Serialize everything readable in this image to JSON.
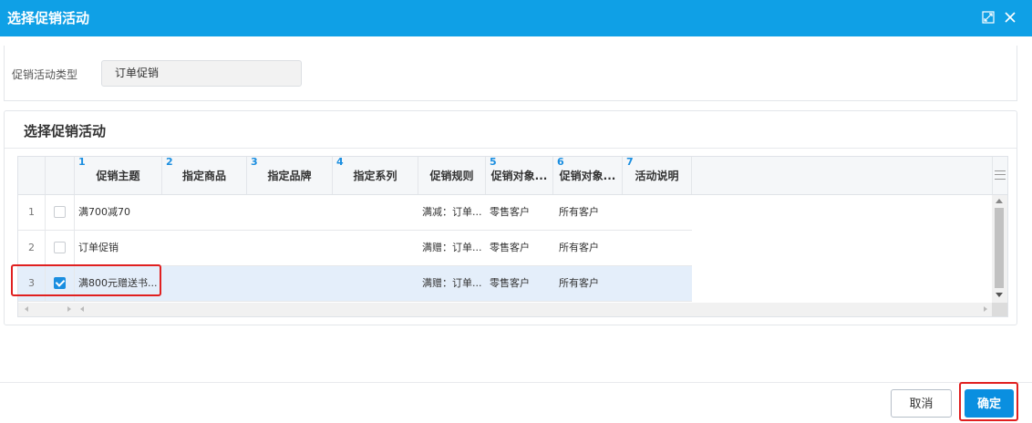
{
  "dialog": {
    "title": "选择促销活动",
    "maximize_icon": "maximize-icon",
    "close_icon": "close-icon"
  },
  "filter": {
    "label": "促销活动类型",
    "value": "订单促销"
  },
  "list": {
    "title": "选择促销活动",
    "columns": [
      {
        "num": "1",
        "label": "促销主题"
      },
      {
        "num": "2",
        "label": "指定商品"
      },
      {
        "num": "3",
        "label": "指定品牌"
      },
      {
        "num": "4",
        "label": "指定系列"
      },
      {
        "num": "",
        "label": "促销规则"
      },
      {
        "num": "5",
        "label": "促销对象..."
      },
      {
        "num": "6",
        "label": "促销对象..."
      },
      {
        "num": "7",
        "label": "活动说明"
      }
    ],
    "rows": [
      {
        "index": "1",
        "checked": false,
        "theme": "满700减70",
        "rule": "满减：订单...",
        "target1": "零售客户",
        "target2": "所有客户"
      },
      {
        "index": "2",
        "checked": false,
        "theme": "订单促销",
        "rule": "满赠：订单...",
        "target1": "零售客户",
        "target2": "所有客户"
      },
      {
        "index": "3",
        "checked": true,
        "theme": "满800元赠送书...",
        "rule": "满赠：订单...",
        "target1": "零售客户",
        "target2": "所有客户"
      }
    ]
  },
  "buttons": {
    "cancel": "取消",
    "ok": "确定"
  },
  "colors": {
    "titlebar": "#0fa0e6",
    "primary": "#0a8fe0",
    "highlight": "#e02020",
    "selected_row": "#e4eefa"
  }
}
